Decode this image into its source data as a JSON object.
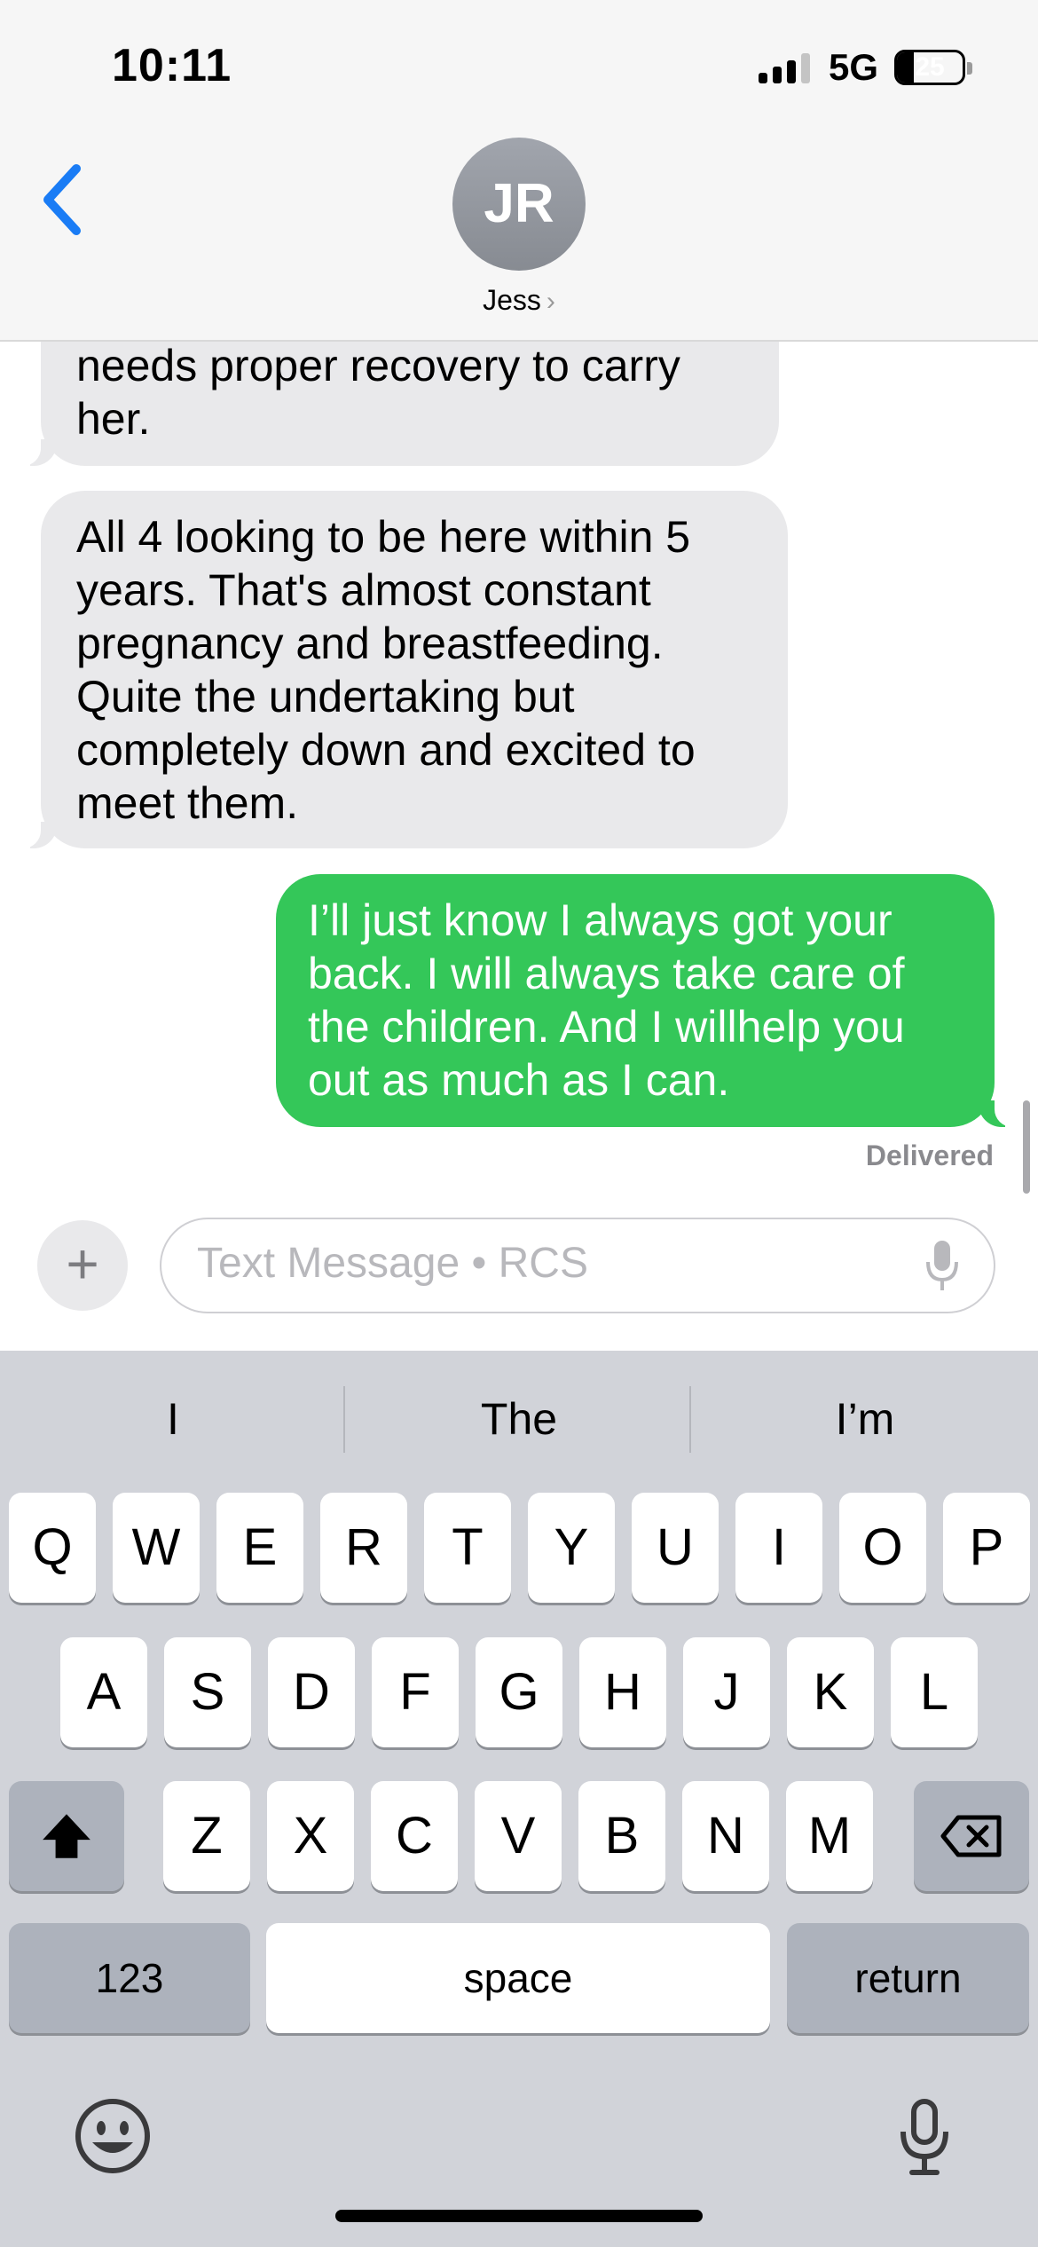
{
  "status_bar": {
    "time": "10:11",
    "network": "5G",
    "battery": "25",
    "battery_level_percent": 25
  },
  "header": {
    "back_icon": "chevron-left-icon",
    "avatar_initials": "JR",
    "contact_name": "Jess",
    "chevron": "›"
  },
  "messages": [
    {
      "direction": "incoming",
      "text": "needs proper recovery to carry\nher."
    },
    {
      "direction": "incoming",
      "text": "All 4 looking to be here within 5\nyears. That's almost constant\npregnancy and breastfeeding.\nQuite the undertaking but\ncompletely down and excited to\nmeet them."
    },
    {
      "direction": "outgoing",
      "text": "I’ll just know I always got your\nback. I will always take care of\nthe children. And I willhelp you\nout as much as I can."
    }
  ],
  "delivered_label": "Delivered",
  "compose": {
    "placeholder": "Text Message • RCS",
    "plus": "+"
  },
  "keyboard": {
    "suggestions": [
      "I",
      "The",
      "I’m"
    ],
    "row1": [
      "Q",
      "W",
      "E",
      "R",
      "T",
      "Y",
      "U",
      "I",
      "O",
      "P"
    ],
    "row2": [
      "A",
      "S",
      "D",
      "F",
      "G",
      "H",
      "J",
      "K",
      "L"
    ],
    "row3": [
      "Z",
      "X",
      "C",
      "V",
      "B",
      "N",
      "M"
    ],
    "numbers_label": "123",
    "space_label": "space",
    "return_label": "return"
  },
  "colors": {
    "outgoing": "#34c759",
    "incoming": "#e9e9eb",
    "accent": "#1a7cf5"
  }
}
